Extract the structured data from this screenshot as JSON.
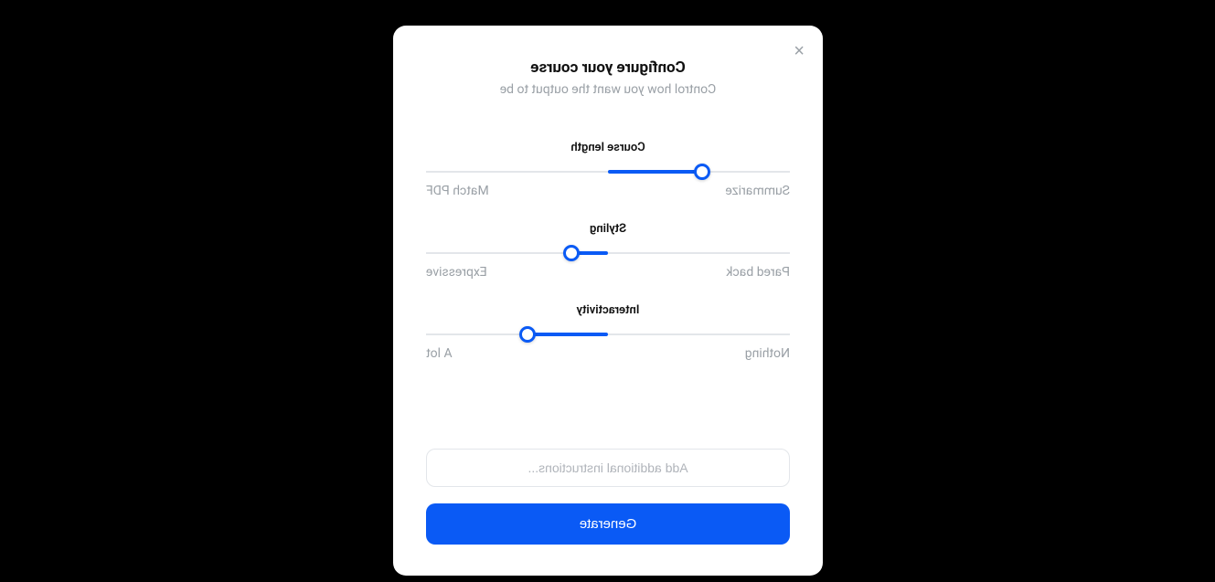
{
  "header": {
    "title": "Configure your course",
    "subtitle": "Control how you want the output to be"
  },
  "close_glyph": "×",
  "sliders": {
    "course_length": {
      "label": "Course length",
      "left": "Summarize",
      "right": "Match PDF",
      "thumb_pct": 24,
      "fill_end_pct": 50
    },
    "styling": {
      "label": "Styling",
      "left": "Pared back",
      "right": "Expressive",
      "thumb_pct": 60,
      "fill_start_pct": 50
    },
    "interactivity": {
      "label": "Interactivity",
      "left": "Nothing",
      "right": "A lot",
      "thumb_pct": 72,
      "fill_start_pct": 50
    }
  },
  "instructions_placeholder": "Add additional instructions...",
  "generate_label": "Generate"
}
